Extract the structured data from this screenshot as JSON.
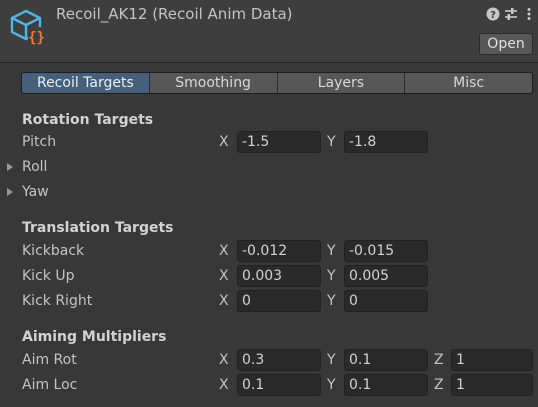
{
  "header": {
    "title": "Recoil_AK12 (Recoil Anim Data)",
    "open_label": "Open",
    "icons": [
      "help-icon",
      "preset-sliders-icon",
      "more-options-icon"
    ]
  },
  "tabs": [
    {
      "label": "Recoil Targets",
      "active": true
    },
    {
      "label": "Smoothing",
      "active": false
    },
    {
      "label": "Layers",
      "active": false
    },
    {
      "label": "Misc",
      "active": false
    }
  ],
  "rotation": {
    "header": "Rotation Targets",
    "pitch": {
      "label": "Pitch",
      "x": "-1.5",
      "y": "-1.8"
    },
    "roll": {
      "label": "Roll"
    },
    "yaw": {
      "label": "Yaw"
    }
  },
  "translation": {
    "header": "Translation Targets",
    "kickback": {
      "label": "Kickback",
      "x": "-0.012",
      "y": "-0.015"
    },
    "kick_up": {
      "label": "Kick Up",
      "x": "0.003",
      "y": "0.005"
    },
    "kick_right": {
      "label": "Kick Right",
      "x": "0",
      "y": "0"
    }
  },
  "aiming": {
    "header": "Aiming Multipliers",
    "aim_rot": {
      "label": "Aim Rot",
      "x": "0.3",
      "y": "0.1",
      "z": "1"
    },
    "aim_loc": {
      "label": "Aim Loc",
      "x": "0.1",
      "y": "0.1",
      "z": "1"
    }
  },
  "axes": {
    "x": "X",
    "y": "Y",
    "z": "Z"
  },
  "colors": {
    "background": "#383838",
    "header": "#3e3e3e",
    "active_tab": "#46607c",
    "field": "#2a2a2a",
    "icon_cube": "#4fb4e6",
    "icon_braces": "#f07a3c"
  }
}
